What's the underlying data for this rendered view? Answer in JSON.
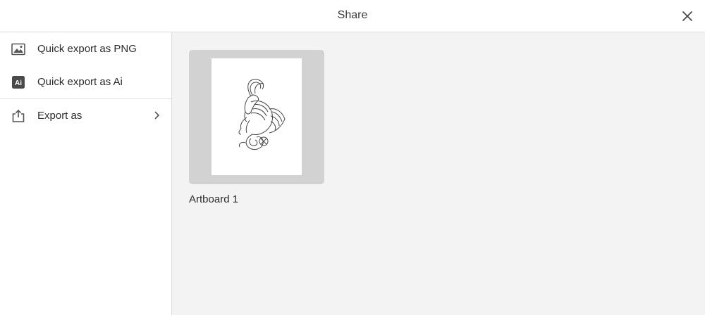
{
  "header": {
    "title": "Share"
  },
  "sidebar": {
    "items": [
      {
        "label": "Quick export as PNG",
        "icon": "image-icon"
      },
      {
        "label": "Quick export as Ai",
        "icon": "ai-file-icon",
        "icon_text": "Ai"
      },
      {
        "label": "Export as",
        "icon": "share-export-icon",
        "has_submenu": true
      }
    ]
  },
  "main": {
    "artboards": [
      {
        "label": "Artboard 1",
        "thumbnail": "goat-line-drawing"
      }
    ]
  },
  "colors": {
    "header_bg": "#ffffff",
    "sidebar_bg": "#ffffff",
    "main_bg": "#f3f3f3",
    "thumb_frame": "#d2d2d2",
    "text": "#2c2c2c",
    "divider": "#dcdcdc"
  }
}
